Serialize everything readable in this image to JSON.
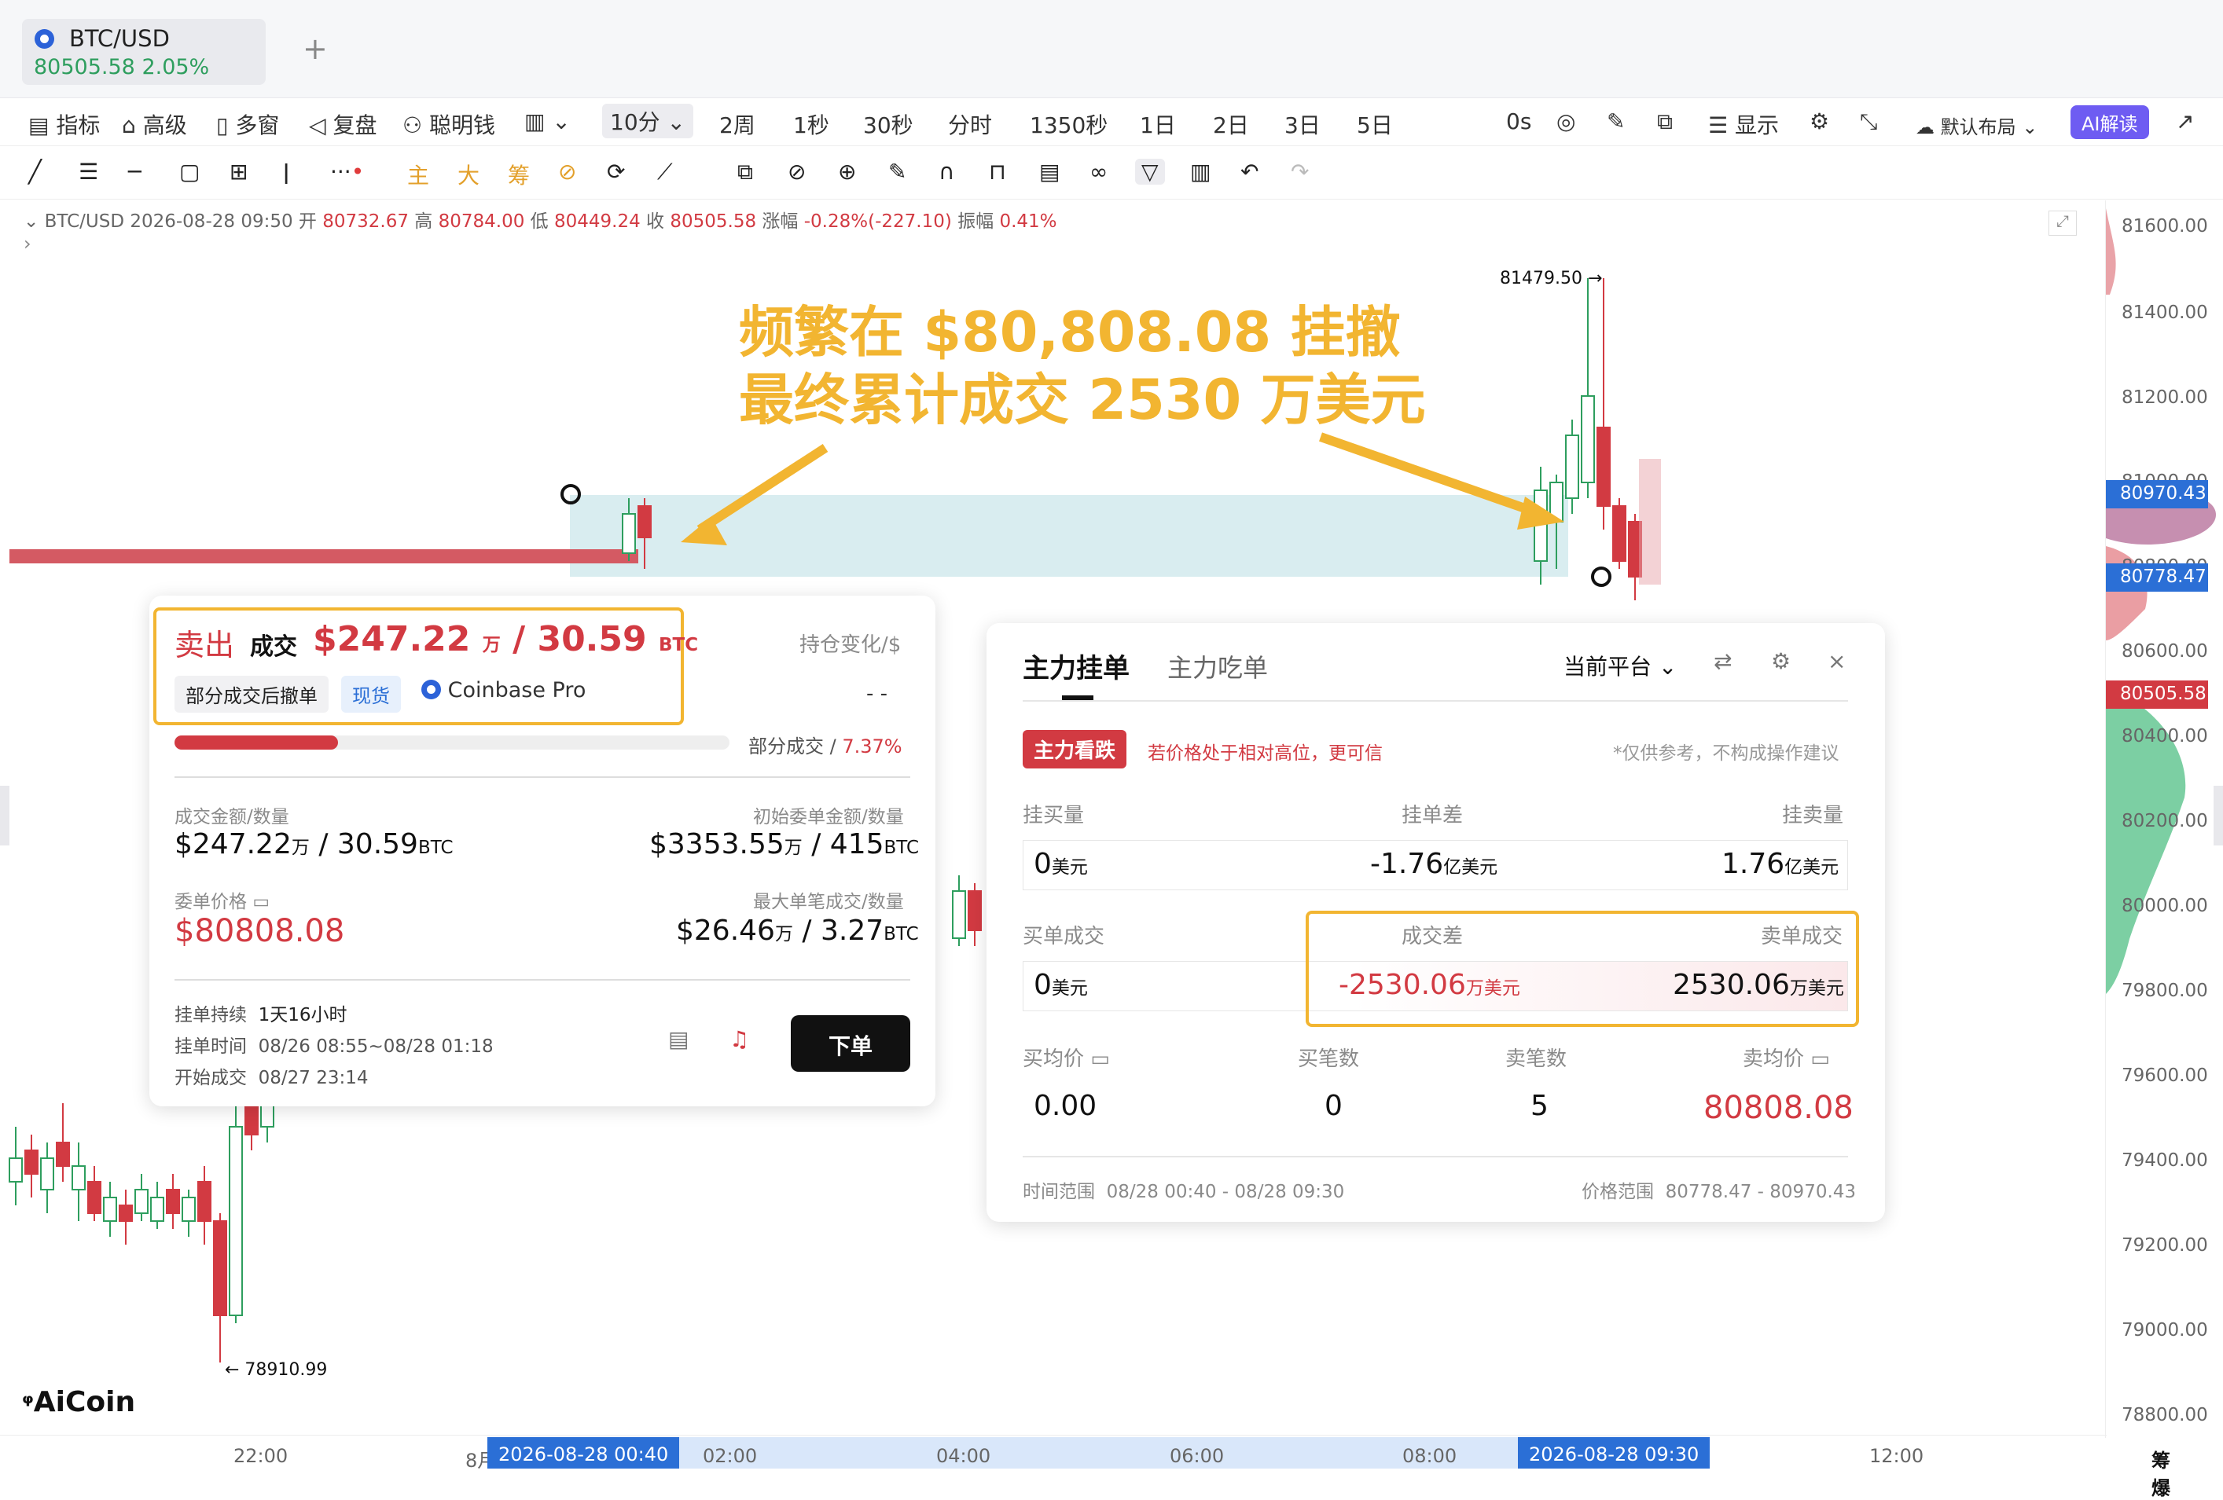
{
  "tab": {
    "symbol": "BTC/USD",
    "price": "80505.58",
    "change": "2.05%",
    "add": "+"
  },
  "toolbar": {
    "items": [
      "指标",
      "高级",
      "多窗",
      "复盘",
      "聪明钱"
    ],
    "interval": "10分",
    "intervals": [
      "2周",
      "1秒",
      "30秒",
      "分时",
      "1350秒",
      "1日",
      "2日",
      "3日",
      "5日"
    ],
    "countdown": "0s",
    "display": "显示",
    "layout": "默认布局",
    "ai": "AI解读"
  },
  "toolbar2": {
    "icons": [
      "line-tool-icon",
      "horizontal-lines-icon",
      "ray-icon",
      "rectangle-icon",
      "measure-icon",
      "vertical-line-icon",
      "more-icon",
      "main-icon",
      "big-icon",
      "chip-icon",
      "pattern-icon",
      "replay-icon",
      "brush-icon",
      "copy-icon",
      "ruler-icon",
      "zoom-icon",
      "marker-icon",
      "magnet-icon",
      "lock-icon",
      "template-icon",
      "link-icon",
      "filter-icon",
      "trash-icon",
      "undo-icon",
      "redo-icon"
    ],
    "labels": {
      "main": "主",
      "big": "大",
      "chip": "筹"
    }
  },
  "ohlc": {
    "symbol": "BTC/USD",
    "time": "2026-08-28 09:50",
    "open_l": "开",
    "open": "80732.67",
    "high_l": "高",
    "high": "80784.00",
    "low_l": "低",
    "low": "80449.24",
    "close_l": "收",
    "close": "80505.58",
    "chg_l": "涨幅",
    "chg": "-0.28%(-227.10)",
    "amp_l": "振幅",
    "amp": "0.41%"
  },
  "annotation": {
    "line1": "频繁在 $80,808.08 挂撤",
    "line2": "最终累计成交 2530 万美元"
  },
  "chart": {
    "high_mark": "81479.50 →",
    "low_mark": "← 78910.99"
  },
  "yaxis": {
    "labels": [
      "81600.00",
      "81400.00",
      "81200.00",
      "81000.00",
      "80800.00",
      "80600.00",
      "80400.00",
      "80200.00",
      "80000.00",
      "79800.00",
      "79600.00",
      "79400.00",
      "79200.00",
      "79000.00",
      "78800.00"
    ],
    "tags": {
      "upper": "80970.43",
      "lower": "80778.47",
      "current": "80505.58"
    },
    "bull_color": "#2e9e5e",
    "bear_color": "#d23a42",
    "accent": "#f2b531"
  },
  "xaxis": {
    "labels": [
      "22:00",
      "8月",
      "02:00",
      "04:00",
      "06:00",
      "08:00",
      "12:00"
    ],
    "start": "2026-08-28 00:40",
    "end": "2026-08-28 09:30",
    "right": "筹 爆"
  },
  "order_card": {
    "side": "卖出",
    "deal": "成交",
    "amount": "$247.22",
    "amount_unit": "万",
    "qty": "/ 30.59",
    "qty_unit": "BTC",
    "pos_change": "持仓变化/$",
    "pos_value": "- -",
    "status": "部分成交后撤单",
    "type": "现货",
    "exchange": "Coinbase Pro",
    "fill_label": "部分成交",
    "fill_pct": "7.37%",
    "fill_frac": 0.0737,
    "deal_amt_l": "成交金额/数量",
    "deal_amt": "$247.22",
    "deal_amt_u": "万",
    "deal_qty": "/ 30.59",
    "deal_qty_u": "BTC",
    "init_amt_l": "初始委单金额/数量",
    "init_amt": "$3353.55",
    "init_amt_u": "万",
    "init_qty": "/ 415",
    "init_qty_u": "BTC",
    "price_l": "委单价格",
    "price": "$80808.08",
    "max_l": "最大单笔成交/数量",
    "max_amt": "$26.46",
    "max_amt_u": "万",
    "max_qty": "/ 3.27",
    "max_qty_u": "BTC",
    "dur_l": "挂单持续",
    "dur": "1天16小时",
    "time_l": "挂单时间",
    "time": "08/26 08:55~08/28 01:18",
    "start_l": "开始成交",
    "start": "08/27 23:14",
    "order_btn": "下单"
  },
  "depth_card": {
    "tab1": "主力挂单",
    "tab2": "主力吃单",
    "platform": "当前平台",
    "tag": "主力看跌",
    "tag_desc": "若价格处于相对高位，更可信",
    "disclaimer": "*仅供参考，不构成操作建议",
    "buy_l": "挂买量",
    "diff_l": "挂单差",
    "sell_l": "挂卖量",
    "buy_v": "0",
    "buy_u": "美元",
    "diff_v": "-1.76",
    "diff_u": "亿美元",
    "sell_v": "1.76",
    "sell_u": "亿美元",
    "bdeal_l": "买单成交",
    "ddiff_l": "成交差",
    "sdeal_l": "卖单成交",
    "bdeal_v": "0",
    "bdeal_u": "美元",
    "ddiff_v": "-2530.06",
    "ddiff_u": "万美元",
    "sdeal_v": "2530.06",
    "sdeal_u": "万美元",
    "bavg_l": "买均价",
    "bcnt_l": "买笔数",
    "scnt_l": "卖笔数",
    "savg_l": "卖均价",
    "bavg": "0.00",
    "bcnt": "0",
    "scnt": "5",
    "savg": "80808.08",
    "time_l": "时间范围",
    "time": "08/28 00:40 - 08/28 09:30",
    "price_l": "价格范围",
    "price": "80778.47 - 80970.43"
  },
  "logo": "AiCoin"
}
